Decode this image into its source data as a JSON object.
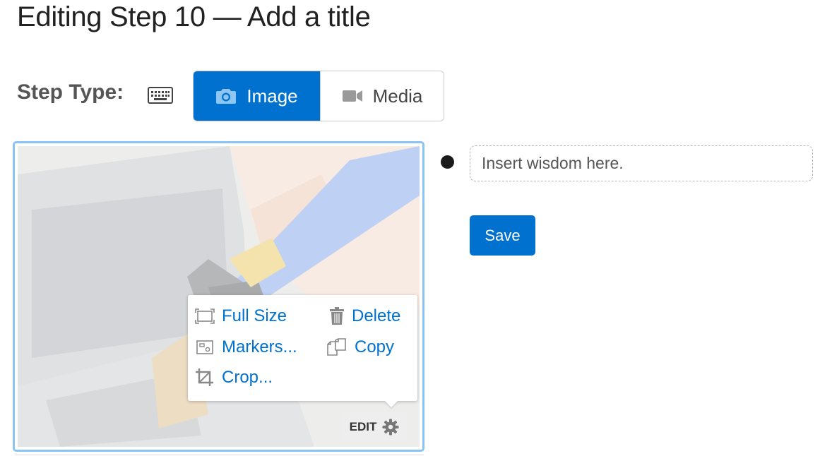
{
  "page": {
    "title": "Editing Step 10 — Add a title"
  },
  "step_type": {
    "label": "Step Type:",
    "keyboard_icon": "keyboard-icon",
    "options": [
      {
        "label": "Image",
        "icon": "camera-icon",
        "selected": true
      },
      {
        "label": "Media",
        "icon": "video-camera-icon",
        "selected": false
      }
    ]
  },
  "image_menu": {
    "items": [
      {
        "label": "Full Size",
        "icon": "full-size-icon"
      },
      {
        "label": "Delete",
        "icon": "trash-icon"
      },
      {
        "label": "Markers...",
        "icon": "markers-icon"
      },
      {
        "label": "Copy",
        "icon": "copy-icon"
      },
      {
        "label": "Crop...",
        "icon": "crop-icon"
      }
    ],
    "edit_label": "EDIT",
    "edit_icon": "gear-icon"
  },
  "bullet": {
    "placeholder": "Insert wisdom here.",
    "value": ""
  },
  "actions": {
    "save_label": "Save"
  },
  "colors": {
    "accent": "#0071ce",
    "image_border": "#8cc3f5"
  }
}
